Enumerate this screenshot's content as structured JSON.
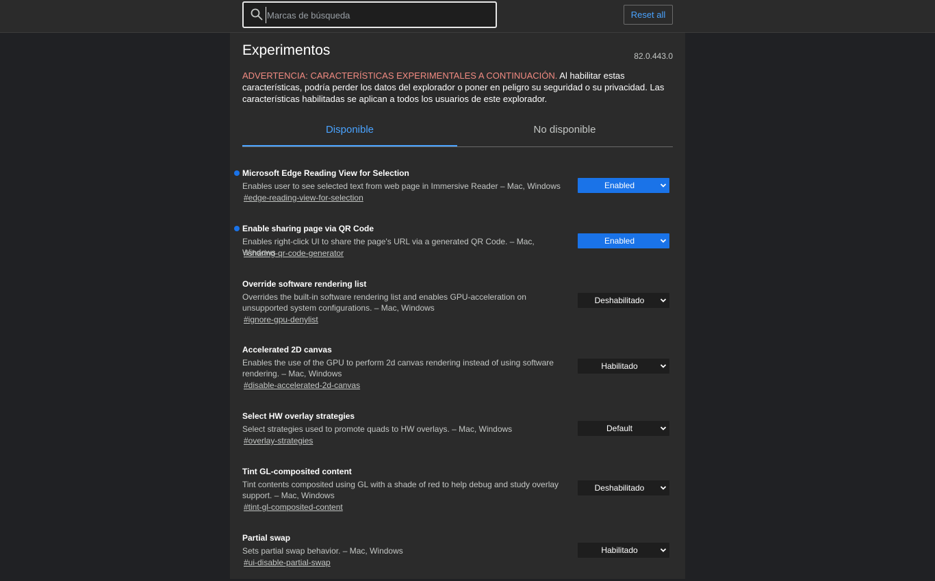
{
  "search": {
    "placeholder": "Marcas de búsqueda"
  },
  "reset_label": "Reset all",
  "page_title": "Experimentos",
  "version": "82.0.443.0",
  "warning": {
    "label": "ADVERTENCIA: CARACTERÍSTICAS EXPERIMENTALES A CONTINUACIÓN.",
    "text": " Al habilitar estas características, podría perder los datos del explorador o poner en peligro su seguridad o su privacidad. Las características habilitadas se aplican a todos los usuarios de este explorador."
  },
  "tabs": [
    {
      "label": "Disponible",
      "active": true
    },
    {
      "label": "No disponible",
      "active": false
    }
  ],
  "experiments": [
    {
      "title": "Microsoft Edge Reading View for Selection",
      "description": "Enables user to see selected text from web page in Immersive Reader – Mac, Windows",
      "link": "#edge-reading-view-for-selection",
      "value": "Enabled",
      "modified": true
    },
    {
      "title": "Enable sharing page via QR Code",
      "description": "Enables right-click UI to share the page's URL via a generated QR Code. – Mac, Windows",
      "link": "#sharing-qr-code-generator",
      "value": "Enabled",
      "modified": true
    },
    {
      "title": "Override software rendering list",
      "description": "Overrides the built-in software rendering list and enables GPU-acceleration on unsupported system configurations. – Mac, Windows",
      "link": "#ignore-gpu-denylist",
      "value": "Deshabilitado",
      "modified": false
    },
    {
      "title": "Accelerated 2D canvas",
      "description": "Enables the use of the GPU to perform 2d canvas rendering instead of using software rendering. – Mac, Windows",
      "link": "#disable-accelerated-2d-canvas",
      "value": "Habilitado",
      "modified": false
    },
    {
      "title": "Select HW overlay strategies",
      "description": "Select strategies used to promote quads to HW overlays. – Mac, Windows",
      "link": "#overlay-strategies",
      "value": "Default",
      "modified": false
    },
    {
      "title": "Tint GL-composited content",
      "description": "Tint contents composited using GL with a shade of red to help debug and study overlay support. – Mac, Windows",
      "link": "#tint-gl-composited-content",
      "value": "Deshabilitado",
      "modified": false
    },
    {
      "title": "Partial swap",
      "description": "Sets partial swap behavior. – Mac, Windows",
      "link": "#ui-disable-partial-swap",
      "value": "Habilitado",
      "modified": false
    }
  ],
  "colors": {
    "accent": "#4aa3ff",
    "enabled_select": "#1a73e8",
    "warning": "#f28b82"
  }
}
